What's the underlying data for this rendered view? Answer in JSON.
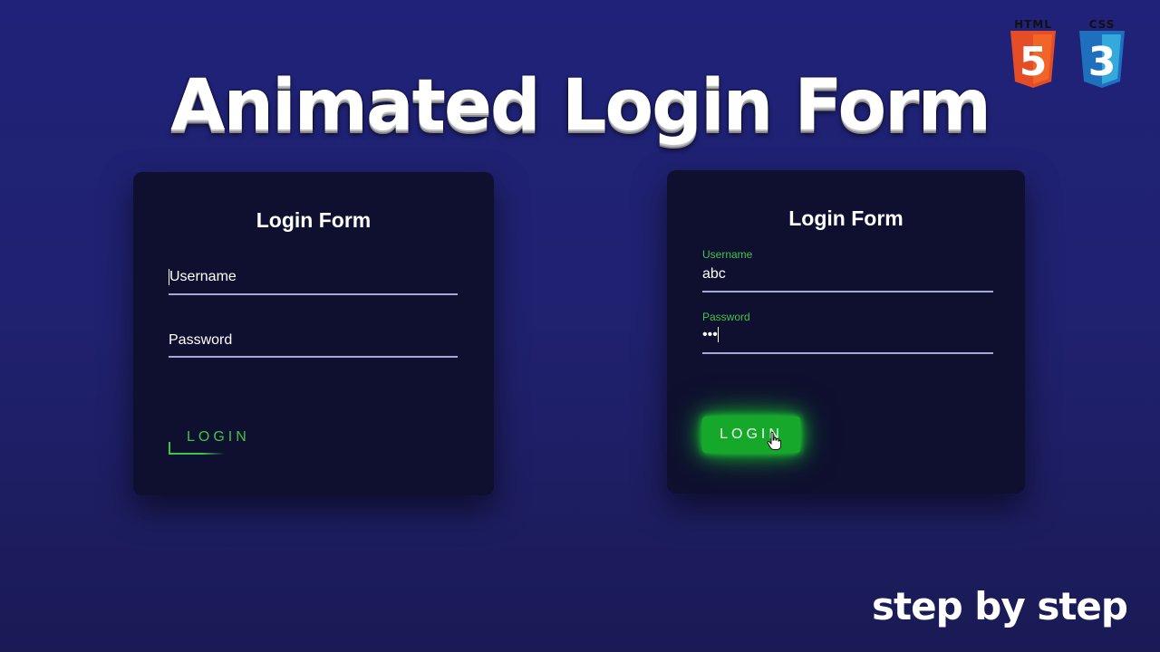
{
  "headline": "Animated Login Form",
  "tagline": "step by step",
  "badges": [
    {
      "caption": "HTML",
      "glyph": "5",
      "icon": "html5-icon",
      "color": "#e44d26"
    },
    {
      "caption": "CSS",
      "glyph": "3",
      "icon": "css3-icon",
      "color": "#2a6ebd"
    }
  ],
  "form_before": {
    "title": "Login Form",
    "username_placeholder": "Username",
    "password_placeholder": "Password",
    "login_label": "LOGIN"
  },
  "form_after": {
    "title": "Login Form",
    "username_label": "Username",
    "username_value": "abc",
    "password_label": "Password",
    "password_value": "•••",
    "login_label": "LOGIN"
  },
  "colors": {
    "accent_green": "#3fc44a",
    "button_green": "#16a82a",
    "card_bg": "#0f0f2f",
    "page_bg": "#1f2278"
  }
}
